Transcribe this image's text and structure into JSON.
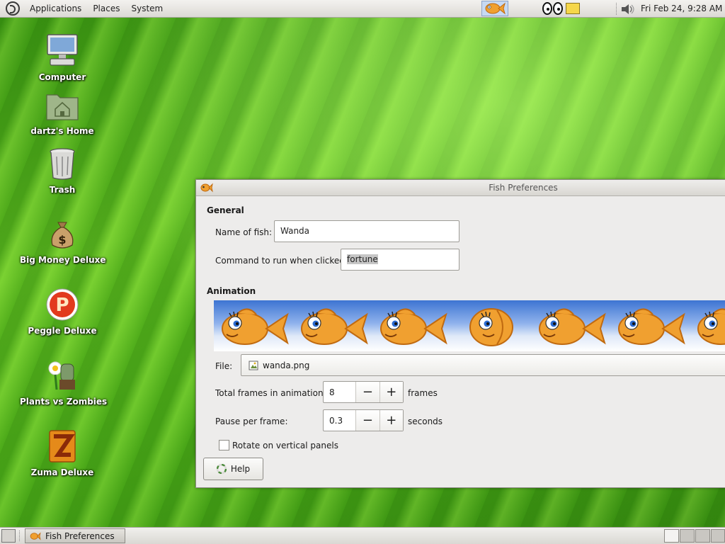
{
  "top_panel": {
    "menus": [
      "Applications",
      "Places",
      "System"
    ],
    "clock": "Fri Feb 24,  9:28 AM"
  },
  "desktop_icons": [
    {
      "label": "Computer",
      "icon": "computer-icon"
    },
    {
      "label": "dartz's Home",
      "icon": "home-folder-icon"
    },
    {
      "label": "Trash",
      "icon": "trash-icon"
    },
    {
      "label": "Big Money Deluxe",
      "icon": "money-bag-icon"
    },
    {
      "label": "Peggle Deluxe",
      "icon": "peggle-icon"
    },
    {
      "label": "Plants vs Zombies",
      "icon": "plants-zombies-icon"
    },
    {
      "label": "Zuma Deluxe",
      "icon": "zuma-icon"
    }
  ],
  "window": {
    "title": "Fish Preferences",
    "general": {
      "heading": "General",
      "name_label": "Name of fish:",
      "name_value": "Wanda",
      "command_label": "Command to run when clicked:",
      "command_value": "fortune"
    },
    "animation": {
      "heading": "Animation",
      "file_label": "File:",
      "file_value": "wanda.png",
      "frames_label": "Total frames in animation:",
      "frames_value": "8",
      "frames_unit": "frames",
      "pause_label": "Pause per frame:",
      "pause_value": "0.3",
      "pause_unit": "seconds",
      "rotate_label": "Rotate on vertical panels",
      "rotate_checked": false
    },
    "help_label": "Help",
    "spin_minus": "−",
    "spin_plus": "+"
  },
  "bottom_panel": {
    "task_label": "Fish Preferences"
  },
  "colors": {
    "fish": "#f0a030",
    "fish_outline": "#c06a10",
    "sky_top": "#3d74d2"
  }
}
